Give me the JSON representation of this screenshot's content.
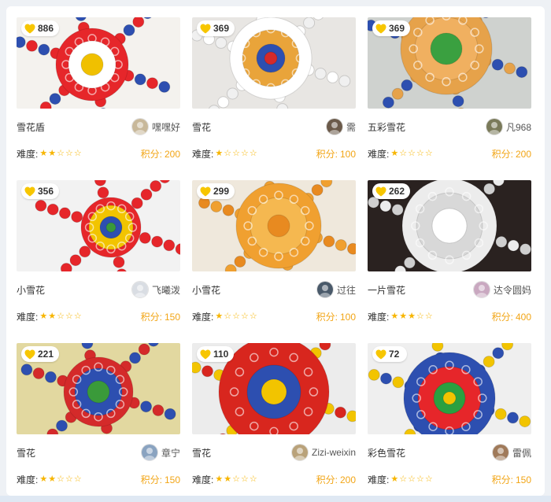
{
  "difficulty_label": "难度:",
  "score_label": "积分:",
  "colors": {
    "star": "#f7b500",
    "score": "#f2a515",
    "heart": "#f7c600"
  },
  "cards": [
    {
      "likes": "886",
      "title": "雪花盾",
      "author": "嘿嘿好",
      "difficulty": 2,
      "score": "200",
      "image": "red-white-snowflake-photo",
      "avatar_color": "#c8b89a"
    },
    {
      "likes": "369",
      "title": "雪花",
      "author": "需",
      "difficulty": 1,
      "score": "100",
      "image": "multicolor-snowflake-photo",
      "avatar_color": "#6b5a4a"
    },
    {
      "likes": "369",
      "title": "五彩雪花",
      "author": "凡968",
      "difficulty": 1,
      "score": "200",
      "image": "rainbow-snowflake-photo",
      "avatar_color": "#7a7a5a"
    },
    {
      "likes": "356",
      "title": "小雪花",
      "author": "飞曦泼",
      "difficulty": 2,
      "score": "150",
      "image": "hand-snowflake-photo",
      "avatar_color": "#d9dde3"
    },
    {
      "likes": "299",
      "title": "小雪花",
      "author": "过往",
      "difficulty": 1,
      "score": "100",
      "image": "orange-snowflake-photo",
      "avatar_color": "#4a5a6a"
    },
    {
      "likes": "262",
      "title": "一片雪花",
      "author": "达令圆妈",
      "difficulty": 3,
      "score": "400",
      "image": "white-snowflake-photo",
      "avatar_color": "#c9a8c0"
    },
    {
      "likes": "221",
      "title": "雪花",
      "author": "章宁",
      "difficulty": 2,
      "score": "150",
      "image": "mat-snowflake-photo",
      "avatar_color": "#8aa3c0"
    },
    {
      "likes": "110",
      "title": "雪花",
      "author": "Zizi-weixin",
      "difficulty": 2,
      "score": "200",
      "image": "plate-snowflake-photo",
      "avatar_color": "#b9a27a"
    },
    {
      "likes": "72",
      "title": "彩色雪花",
      "author": "雷佩",
      "difficulty": 1,
      "score": "150",
      "image": "color-gear-snowflake-photo",
      "avatar_color": "#a07a5a"
    }
  ]
}
